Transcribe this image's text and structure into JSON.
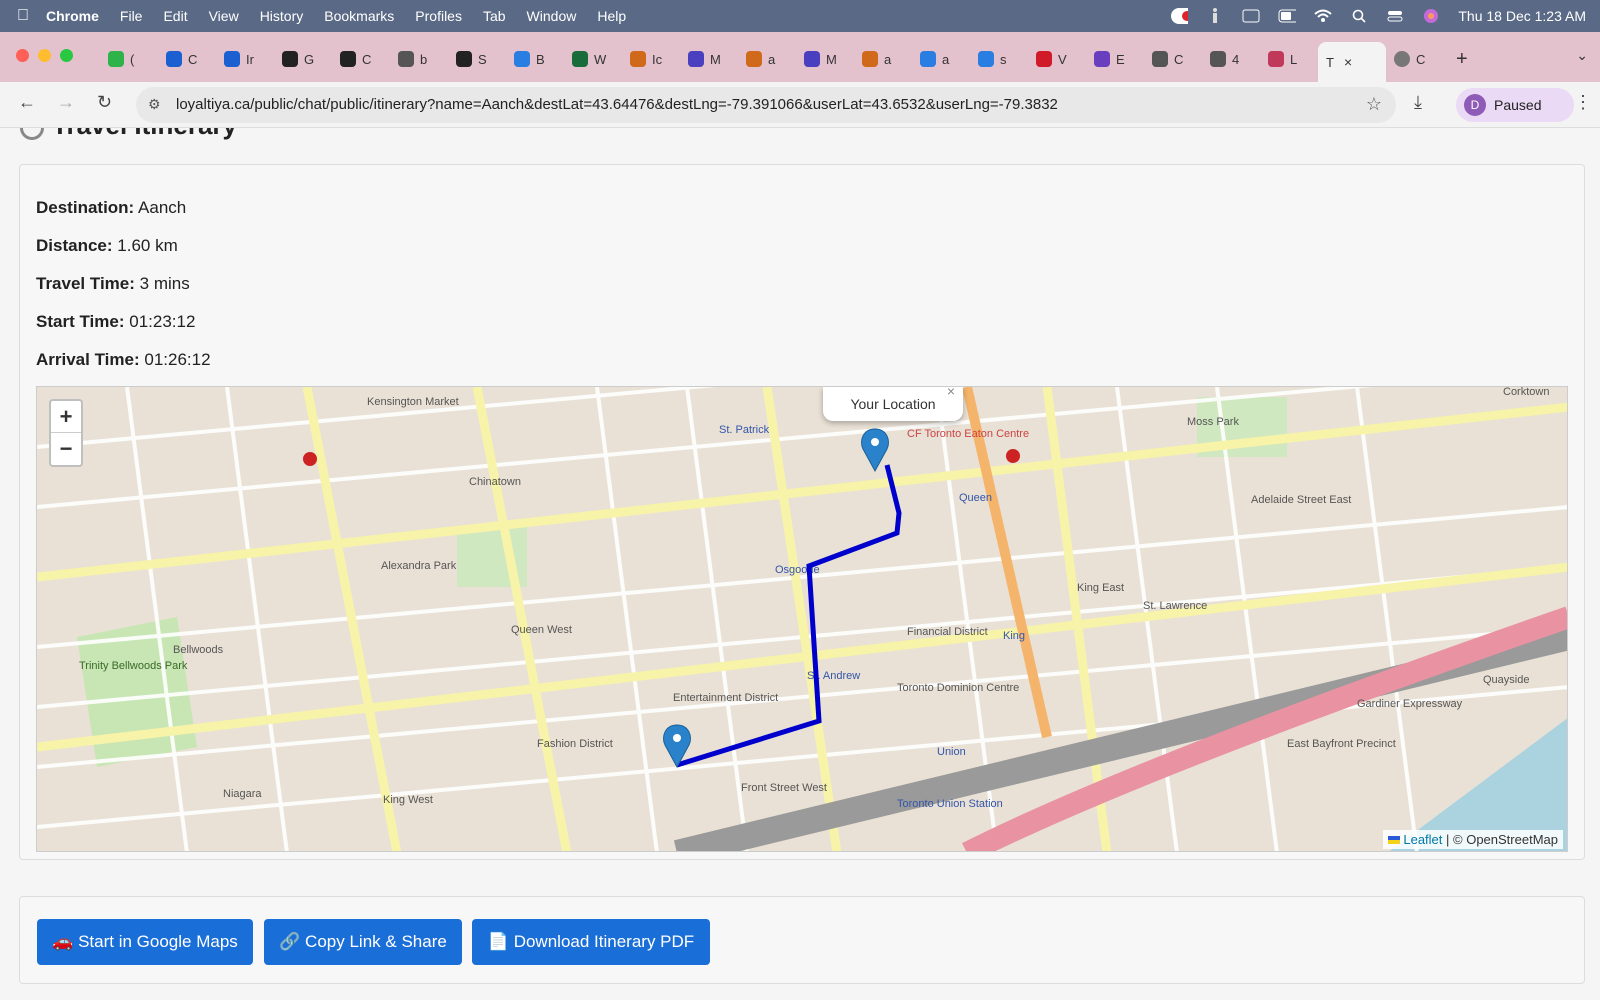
{
  "menubar": {
    "app": "Chrome",
    "items": [
      "File",
      "Edit",
      "View",
      "History",
      "Bookmarks",
      "Profiles",
      "Tab",
      "Window",
      "Help"
    ],
    "datetime": "Thu 18 Dec  1:23 AM"
  },
  "tabs": [
    {
      "label": "(",
      "color": "#2db34a"
    },
    {
      "label": "C",
      "color": "#1b5fd1"
    },
    {
      "label": "Ir",
      "color": "#1b5fd1"
    },
    {
      "label": "G",
      "color": "#222222"
    },
    {
      "label": "C",
      "color": "#222222"
    },
    {
      "label": "b",
      "color": "#555555"
    },
    {
      "label": "S",
      "color": "#222222"
    },
    {
      "label": "B",
      "color": "#2a7de1"
    },
    {
      "label": "W",
      "color": "#1a6b3a"
    },
    {
      "label": "Ic",
      "color": "#d06a1a"
    },
    {
      "label": "M",
      "color": "#4a3fbf"
    },
    {
      "label": "a",
      "color": "#d06a1a"
    },
    {
      "label": "M",
      "color": "#4a3fbf"
    },
    {
      "label": "a",
      "color": "#d06a1a"
    },
    {
      "label": "a",
      "color": "#2a7de1"
    },
    {
      "label": "s",
      "color": "#2a7de1"
    },
    {
      "label": "V",
      "color": "#d01a2a"
    },
    {
      "label": "E",
      "color": "#6a3fbf"
    },
    {
      "label": "C",
      "color": "#555555"
    },
    {
      "label": "4",
      "color": "#555555"
    },
    {
      "label": "L",
      "color": "#c0395a"
    }
  ],
  "active_tab": {
    "label": "T"
  },
  "last_tab": {
    "label": "C"
  },
  "address_bar": {
    "url": "loyaltiya.ca/public/chat/public/itinerary?name=Aanch&destLat=43.64476&destLng=-79.391066&userLat=43.6532&userLng=-79.3832"
  },
  "profile": {
    "initial": "D",
    "status": "Paused"
  },
  "page": {
    "title": "Travel Itinerary",
    "destination_label": "Destination:",
    "destination": "Aanch",
    "distance_label": "Distance:",
    "distance": "1.60 km",
    "travel_time_label": "Travel Time:",
    "travel_time": "3 mins",
    "start_time_label": "Start Time:",
    "start_time": "01:23:12",
    "arrival_time_label": "Arrival Time:",
    "arrival_time": "01:26:12"
  },
  "map": {
    "popup": "Your Location",
    "zoom_in": "+",
    "zoom_out": "−",
    "attribution_leaflet": "Leaflet",
    "attribution_osm": "| © OpenStreetMap",
    "route_color": "#0000cc",
    "labels": [
      "Kensington Market",
      "Chinatown",
      "Alexandra Park",
      "Queen West",
      "Trinity Bellwoods Park",
      "Bellwoods",
      "Niagara",
      "King West",
      "Fashion District",
      "Entertainment District",
      "St. Patrick",
      "Osgoode",
      "St. Andrew",
      "Financial District",
      "King",
      "Queen",
      "Toronto Dominion Centre",
      "Union",
      "Toronto Union Station",
      "CF Toronto Eaton Centre",
      "Moss Park",
      "King East",
      "St. Lawrence",
      "Gardiner Expressway",
      "Front Street West",
      "East Bayfront Precinct",
      "Adelaide Street East",
      "Corktown",
      "Quayside"
    ]
  },
  "buttons": {
    "google_maps": "🚗 Start in Google Maps",
    "copy_link": "🔗 Copy Link & Share",
    "download_pdf": "📄 Download Itinerary PDF"
  }
}
